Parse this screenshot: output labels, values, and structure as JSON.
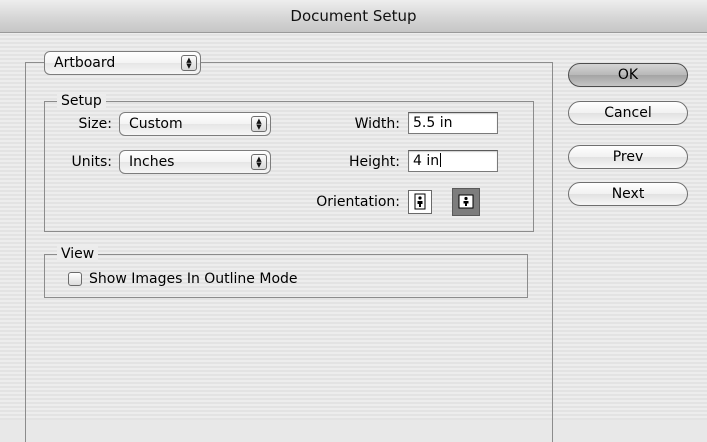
{
  "window": {
    "title": "Document Setup"
  },
  "section_popup": {
    "value": "Artboard"
  },
  "setup": {
    "legend": "Setup",
    "size_label": "Size:",
    "size_value": "Custom",
    "units_label": "Units:",
    "units_value": "Inches",
    "width_label": "Width:",
    "width_value": "5.5 in",
    "height_label": "Height:",
    "height_value": "4 in",
    "orientation_label": "Orientation:",
    "orientation_selected": "landscape"
  },
  "view": {
    "legend": "View",
    "show_images_label": "Show Images In Outline Mode",
    "show_images_checked": false
  },
  "buttons": {
    "ok": "OK",
    "cancel": "Cancel",
    "prev": "Prev",
    "next": "Next"
  },
  "icons": {
    "popup_arrows": "up-down-arrows-icon",
    "portrait": "portrait-orientation-icon",
    "landscape": "landscape-orientation-icon"
  }
}
